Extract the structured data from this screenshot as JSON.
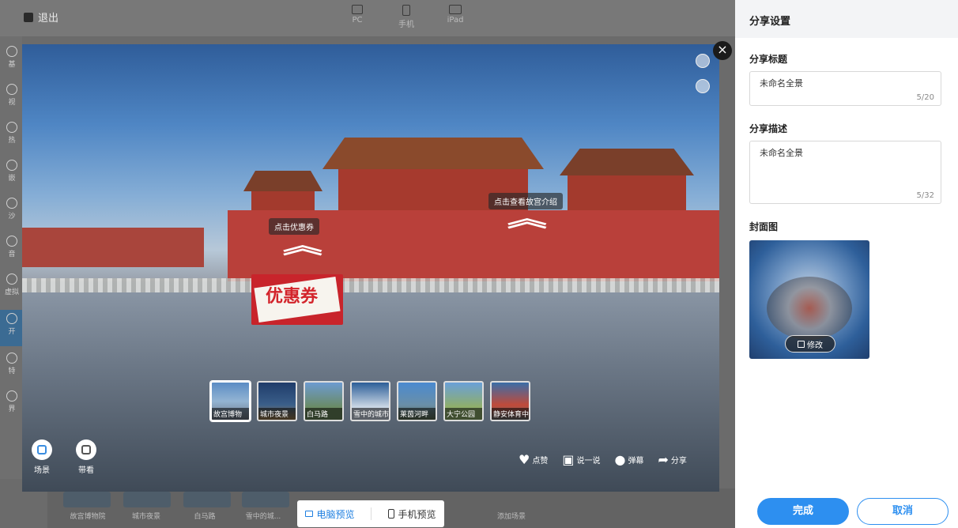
{
  "topbar": {
    "exit_label": "退出",
    "devices": [
      {
        "label": "PC"
      },
      {
        "label": "手机"
      },
      {
        "label": "iPad"
      }
    ]
  },
  "sidebar": {
    "items": [
      "基",
      "视",
      "热",
      "嵌",
      "沙",
      "音",
      "虚拟",
      "开",
      "特",
      "界"
    ]
  },
  "bg_scenes": [
    "故宫博物院",
    "城市夜景",
    "白马路",
    "雪中的城...",
    "添加场景"
  ],
  "preview": {
    "hotspots": [
      {
        "label": "点击优惠券"
      },
      {
        "label": "点击查看故宫介绍"
      }
    ],
    "coupon_text": "优惠券",
    "scenes": [
      {
        "label": "故宫博物"
      },
      {
        "label": "城市夜景"
      },
      {
        "label": "白马路"
      },
      {
        "label": "雪中的城市"
      },
      {
        "label": "莱茵河畔"
      },
      {
        "label": "大宁公园"
      },
      {
        "label": "静安体育中"
      }
    ],
    "left_buttons": [
      {
        "label": "场景",
        "icon": "layers-icon"
      },
      {
        "label": "带看",
        "icon": "guide-icon"
      }
    ],
    "actions": [
      {
        "label": "点赞",
        "icon": "heart-icon"
      },
      {
        "label": "说一说",
        "icon": "chat-icon"
      },
      {
        "label": "弹幕",
        "icon": "danmaku-icon"
      },
      {
        "label": "分享",
        "icon": "share-icon"
      }
    ]
  },
  "preview_switch": {
    "pc_label": "电脑预览",
    "mobile_label": "手机预览"
  },
  "panel": {
    "title": "分享设置",
    "share_title_label": "分享标题",
    "share_title_value": "未命名全景",
    "share_title_count": "5/20",
    "share_desc_label": "分享描述",
    "share_desc_value": "未命名全景",
    "share_desc_count": "5/32",
    "cover_label": "封面图",
    "edit_label": "修改",
    "done_label": "完成",
    "cancel_label": "取消"
  },
  "colors": {
    "accent": "#2d8ff0",
    "overlay": "#6b6b6b"
  }
}
